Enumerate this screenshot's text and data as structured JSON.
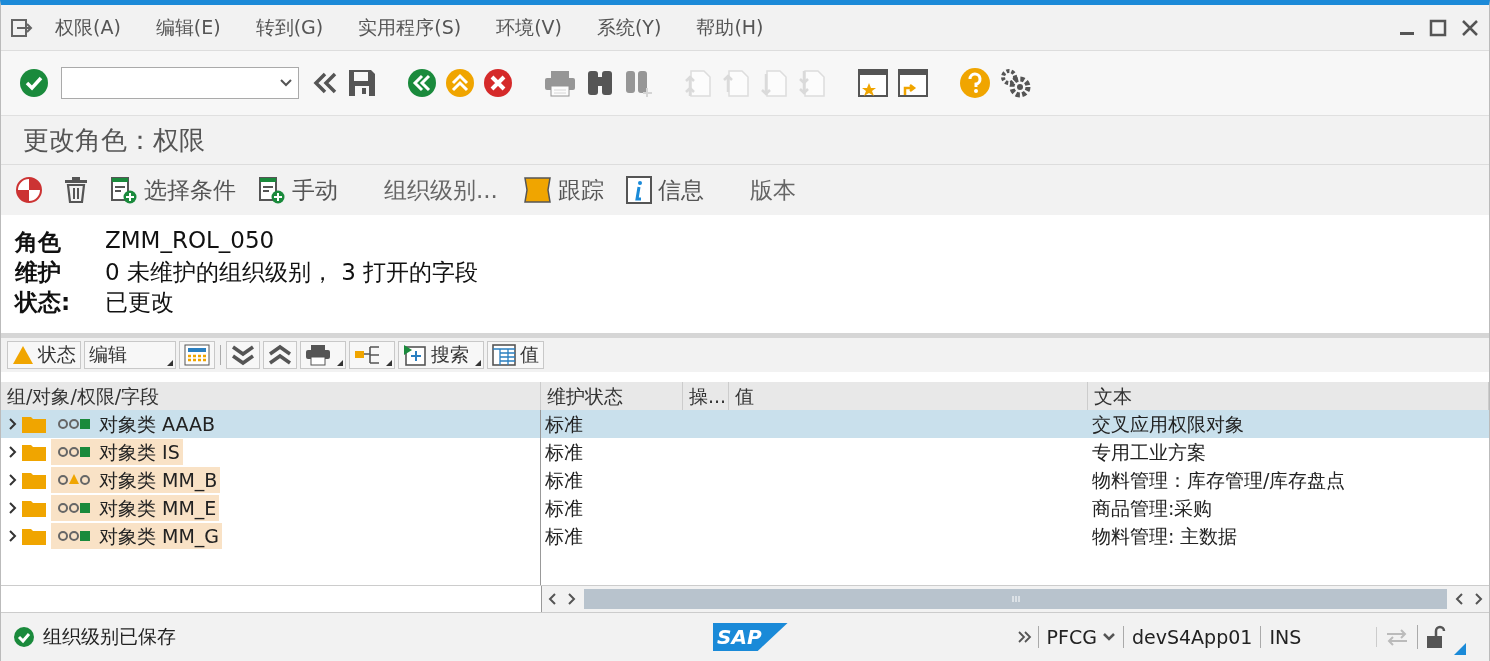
{
  "menu": [
    {
      "label": "权限(A)"
    },
    {
      "label": "编辑(E)"
    },
    {
      "label": "转到(G)"
    },
    {
      "label": "实用程序(S)"
    },
    {
      "label": "环境(V)"
    },
    {
      "label": "系统(Y)"
    },
    {
      "label": "帮助(H)"
    }
  ],
  "toolbar": {
    "buttons": [
      {
        "kind": "enter",
        "disabled": false
      },
      {
        "kind": "command-field",
        "disabled": false
      },
      {
        "kind": "hide-field",
        "disabled": false
      },
      {
        "kind": "save",
        "disabled": false
      },
      {
        "kind": "back",
        "disabled": false
      },
      {
        "kind": "exit",
        "disabled": false
      },
      {
        "kind": "cancel",
        "disabled": false
      },
      {
        "kind": "print",
        "disabled": true
      },
      {
        "kind": "find",
        "disabled": false
      },
      {
        "kind": "find-next",
        "disabled": true
      },
      {
        "kind": "first-page",
        "disabled": true
      },
      {
        "kind": "prev-page",
        "disabled": true
      },
      {
        "kind": "next-page",
        "disabled": true
      },
      {
        "kind": "last-page",
        "disabled": true
      },
      {
        "kind": "new-session",
        "disabled": false
      },
      {
        "kind": "shortcut",
        "disabled": false
      },
      {
        "kind": "help",
        "disabled": false
      },
      {
        "kind": "settings",
        "disabled": false
      }
    ]
  },
  "title": "更改角色：权限",
  "app_toolbar": [
    {
      "kind": "toggle"
    },
    {
      "kind": "delete"
    },
    {
      "kind": "add-doc",
      "label": "选择条件"
    },
    {
      "kind": "add-doc",
      "label": "手动"
    },
    {
      "kind": "text",
      "label": "组织级别..."
    },
    {
      "kind": "trace",
      "label": "跟踪"
    },
    {
      "kind": "info",
      "label": "信息"
    },
    {
      "kind": "text",
      "label": "版本"
    }
  ],
  "header": [
    {
      "label": "角色",
      "value": "ZMM_ROL_050"
    },
    {
      "label": "维护",
      "value": "0 未维护的组织级别， 3 打开的字段"
    },
    {
      "label": "状态:",
      "value": "已更改"
    }
  ],
  "alv_toolbar": [
    {
      "kind": "status",
      "label": "状态",
      "menu": false
    },
    {
      "kind": "text",
      "label": "编辑",
      "menu": true
    },
    {
      "kind": "layout",
      "menu": false
    },
    {
      "kind": "separator"
    },
    {
      "kind": "expand",
      "menu": false
    },
    {
      "kind": "collapse",
      "menu": false
    },
    {
      "kind": "print",
      "menu": true
    },
    {
      "kind": "tree",
      "menu": true
    },
    {
      "kind": "search",
      "label": "搜索",
      "menu": true
    },
    {
      "kind": "values",
      "label": "值",
      "menu": false
    }
  ],
  "tree": {
    "columns": [
      {
        "label": "组/对象/权限/字段"
      },
      {
        "label": "维护状态"
      },
      {
        "label": "操..."
      },
      {
        "label": "值"
      },
      {
        "label": "文本"
      }
    ],
    "rows": [
      {
        "label": "对象类 AAAB",
        "kind": "ok",
        "expanded": false,
        "selected": true,
        "maintenance": "标准",
        "text": "交叉应用权限对象"
      },
      {
        "label": "对象类 IS",
        "kind": "ok",
        "expanded": false,
        "selected": false,
        "maintenance": "标准",
        "text": "专用工业方案"
      },
      {
        "label": "对象类 MM_B",
        "kind": "warning",
        "expanded": false,
        "selected": false,
        "maintenance": "标准",
        "text": "物料管理：库存管理/库存盘点"
      },
      {
        "label": "对象类 MM_E",
        "kind": "ok",
        "expanded": false,
        "selected": false,
        "maintenance": "标准",
        "text": "商品管理:采购"
      },
      {
        "label": "对象类 MM_G",
        "kind": "ok",
        "expanded": false,
        "selected": false,
        "maintenance": "标准",
        "text": "物料管理: 主数据"
      }
    ]
  },
  "status_bar": {
    "message": {
      "kind": "success",
      "text": "组织级别已保存"
    },
    "logo": "SAP",
    "transaction": "PFCG",
    "system": "devS4App01",
    "mode": "INS"
  }
}
